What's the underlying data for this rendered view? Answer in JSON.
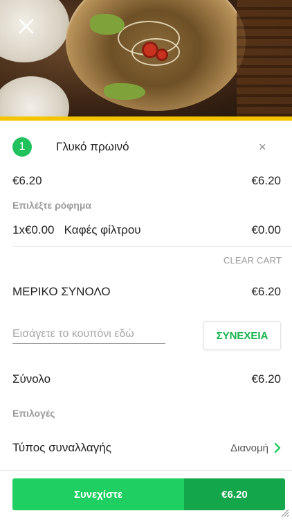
{
  "hero": {
    "image_alt": "Bowl of noodle soup"
  },
  "cart_item": {
    "quantity": "1",
    "name": "Γλυκό πρωινό",
    "unit_price": "€6.20",
    "line_total": "€6.20",
    "choice_label": "Επιλέξτε ρόφημα",
    "choice": {
      "qty_price": "1x€0.00",
      "name": "Καφές φίλτρου",
      "price": "€0.00"
    }
  },
  "actions": {
    "clear_cart": "CLEAR CART"
  },
  "subtotal": {
    "label": "ΜΕΡΙΚΟ ΣΥΝΟΛΟ",
    "value": "€6.20"
  },
  "coupon": {
    "placeholder": "Εισάγετε το κουπόνι εδώ",
    "value": "",
    "button": "ΣΥΝΕΧΕΙΑ"
  },
  "total": {
    "label": "Σύνολο",
    "value": "€6.20"
  },
  "options": {
    "section_label": "Επιλογές",
    "transaction_type_label": "Τύπος συναλλαγής",
    "transaction_type_value": "Διανομή"
  },
  "checkout": {
    "label": "Συνεχίστε",
    "amount": "€6.20"
  },
  "colors": {
    "accent_green": "#1fcf62",
    "dark_green": "#13a64a",
    "stripe_yellow": "#f5c400"
  }
}
